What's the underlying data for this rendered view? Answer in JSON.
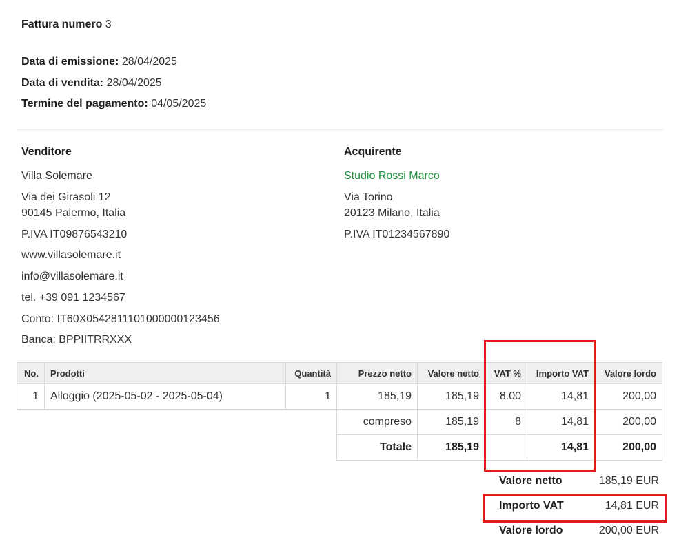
{
  "invoice": {
    "title_label": "Fattura numero",
    "number": "3",
    "issue_label": "Data di emissione:",
    "issue_date": "28/04/2025",
    "sale_label": "Data di vendita:",
    "sale_date": "28/04/2025",
    "due_label": "Termine del pagamento:",
    "due_date": "04/05/2025"
  },
  "seller": {
    "heading": "Venditore",
    "name": "Villa Solemare",
    "street": "Via dei Girasoli 12",
    "city": "90145 Palermo, Italia",
    "vat": "P.IVA IT09876543210",
    "website": "www.villasolemare.it",
    "email": "info@villasolemare.it",
    "phone": "tel. +39 091 1234567",
    "account": "Conto: IT60X0542811101000000123456",
    "bank": "Banca: BPPIITRRXXX"
  },
  "buyer": {
    "heading": "Acquirente",
    "name": "Studio Rossi Marco",
    "street": "Via Torino",
    "city": "20123 Milano, Italia",
    "vat": "P.IVA IT01234567890"
  },
  "table": {
    "headers": [
      "No.",
      "Prodotti",
      "Quantità",
      "Prezzo netto",
      "Valore netto",
      "VAT %",
      "Importo VAT",
      "Valore lordo"
    ],
    "items": [
      {
        "no": "1",
        "product": "Alloggio (2025-05-02 - 2025-05-04)",
        "qty": "1",
        "unit_net": "185,19",
        "net": "185,19",
        "vat_pct": "8.00",
        "vat_amount": "14,81",
        "gross": "200,00"
      }
    ],
    "included": {
      "label": "compreso",
      "net": "185,19",
      "vat_pct": "8",
      "vat_amount": "14,81",
      "gross": "200,00"
    },
    "total": {
      "label": "Totale",
      "net": "185,19",
      "vat_amount": "14,81",
      "gross": "200,00"
    }
  },
  "summary": {
    "net_label": "Valore netto",
    "net_value": "185,19 EUR",
    "vat_label": "Importo VAT",
    "vat_value": "14,81 EUR",
    "gross_label": "Valore lordo",
    "gross_value": "200,00 EUR"
  },
  "highlight_color": "#e21a1a",
  "link_color": "#1e8f3c"
}
